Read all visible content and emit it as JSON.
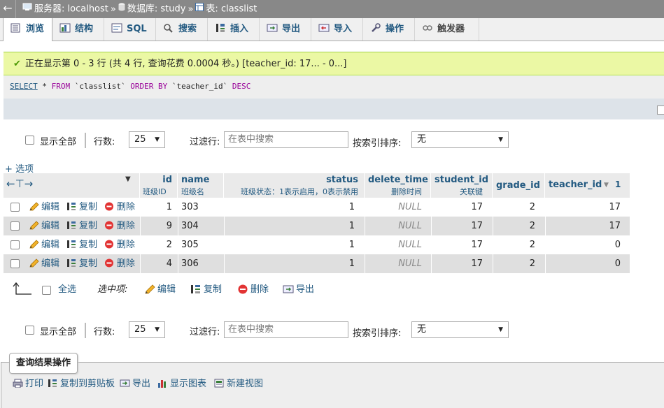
{
  "breadcrumb": {
    "back_glyph": "←",
    "server_label": "服务器:",
    "server": "localhost",
    "db_label": "数据库:",
    "db": "study",
    "table_label": "表:",
    "table": "classlist",
    "separator": "»"
  },
  "tabs": [
    {
      "label": "浏览",
      "icon": "browse-icon"
    },
    {
      "label": "结构",
      "icon": "structure-icon"
    },
    {
      "label": "SQL",
      "icon": "sql-icon"
    },
    {
      "label": "搜索",
      "icon": "search-icon"
    },
    {
      "label": "插入",
      "icon": "insert-icon"
    },
    {
      "label": "导出",
      "icon": "export-icon"
    },
    {
      "label": "导入",
      "icon": "import-icon"
    },
    {
      "label": "操作",
      "icon": "wrench-icon"
    },
    {
      "label": "触发器",
      "icon": "triggers-icon"
    }
  ],
  "success": {
    "message": "正在显示第 0 - 3 行 (共 4 行, 查询花费 0.0004 秒。) [teacher_id: 17... - 0...]"
  },
  "sql": {
    "select": "SELECT",
    "star": " * ",
    "from": "FROM",
    "table": " `classlist` ",
    "order_by": "ORDER BY",
    "column": " `teacher_id` ",
    "desc": "DESC"
  },
  "nav": {
    "show_all": "显示全部",
    "rows_label": "行数:",
    "rows_value": "25",
    "filter_label": "过滤行:",
    "filter_placeholder": "在表中搜索",
    "sort_label": "按索引排序:",
    "sort_value": "无"
  },
  "options_link": "+ 选项",
  "columns": [
    {
      "name": "id",
      "comment": "班级ID"
    },
    {
      "name": "name",
      "comment": "班级名"
    },
    {
      "name": "status",
      "comment": "班级状态：1表示启用，0表示禁用"
    },
    {
      "name": "delete_time",
      "comment": "删除时间"
    },
    {
      "name": "student_id",
      "comment": "关联键"
    },
    {
      "name": "grade_id",
      "comment": ""
    },
    {
      "name": "teacher_id",
      "comment": ""
    }
  ],
  "sort_order_badge": "1",
  "row_actions": {
    "edit": "编辑",
    "copy": "复制",
    "delete": "删除"
  },
  "rows": [
    {
      "id": "1",
      "name": "303",
      "status": "1",
      "delete_time": "NULL",
      "student_id": "17",
      "grade_id": "2",
      "teacher_id": "17"
    },
    {
      "id": "9",
      "name": "304",
      "status": "1",
      "delete_time": "NULL",
      "student_id": "17",
      "grade_id": "2",
      "teacher_id": "17"
    },
    {
      "id": "2",
      "name": "305",
      "status": "1",
      "delete_time": "NULL",
      "student_id": "17",
      "grade_id": "2",
      "teacher_id": "0"
    },
    {
      "id": "4",
      "name": "306",
      "status": "1",
      "delete_time": "NULL",
      "student_id": "17",
      "grade_id": "2",
      "teacher_id": "0"
    }
  ],
  "with_selected": {
    "select_all": "全选",
    "label": "选中项:",
    "edit": "编辑",
    "copy": "复制",
    "delete": "删除",
    "export": "导出"
  },
  "query_results": {
    "legend": "查询结果操作",
    "print": "打印",
    "copy_clipboard": "复制到剪贴板",
    "export": "导出",
    "show_chart": "显示图表",
    "create_view": "新建视图"
  },
  "colors": {
    "link": "#235a81",
    "success_bg": "#ebf8a4",
    "row_even": "#dfdfdf",
    "header_bg": "#eaeaea"
  }
}
